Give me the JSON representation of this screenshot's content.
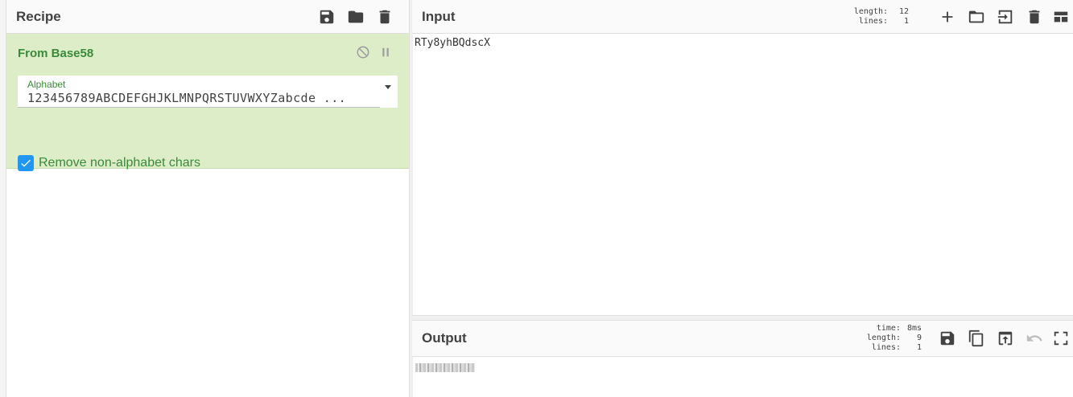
{
  "recipe": {
    "title": "Recipe",
    "operation": {
      "name": "From Base58",
      "alphabet_label": "Alphabet",
      "alphabet_value": "123456789ABCDEFGHJKLMNPQRSTUVWXYZabcde ...",
      "checkbox_label": "Remove non-alphabet chars",
      "checkbox_checked": true
    }
  },
  "input": {
    "title": "Input",
    "stats": {
      "length_key": "length:",
      "length_val": "12",
      "lines_key": "lines:",
      "lines_val": "1"
    },
    "text": "RTy8yhBQdscX"
  },
  "output": {
    "title": "Output",
    "stats": {
      "time_key": "time:",
      "time_val": "8ms",
      "length_key": "length:",
      "length_val": "9",
      "lines_key": "lines:",
      "lines_val": "1"
    }
  },
  "colors": {
    "operation_bg": "#dcedc8",
    "operation_text": "#3a8a3a",
    "checkbox": "#2196f3"
  }
}
